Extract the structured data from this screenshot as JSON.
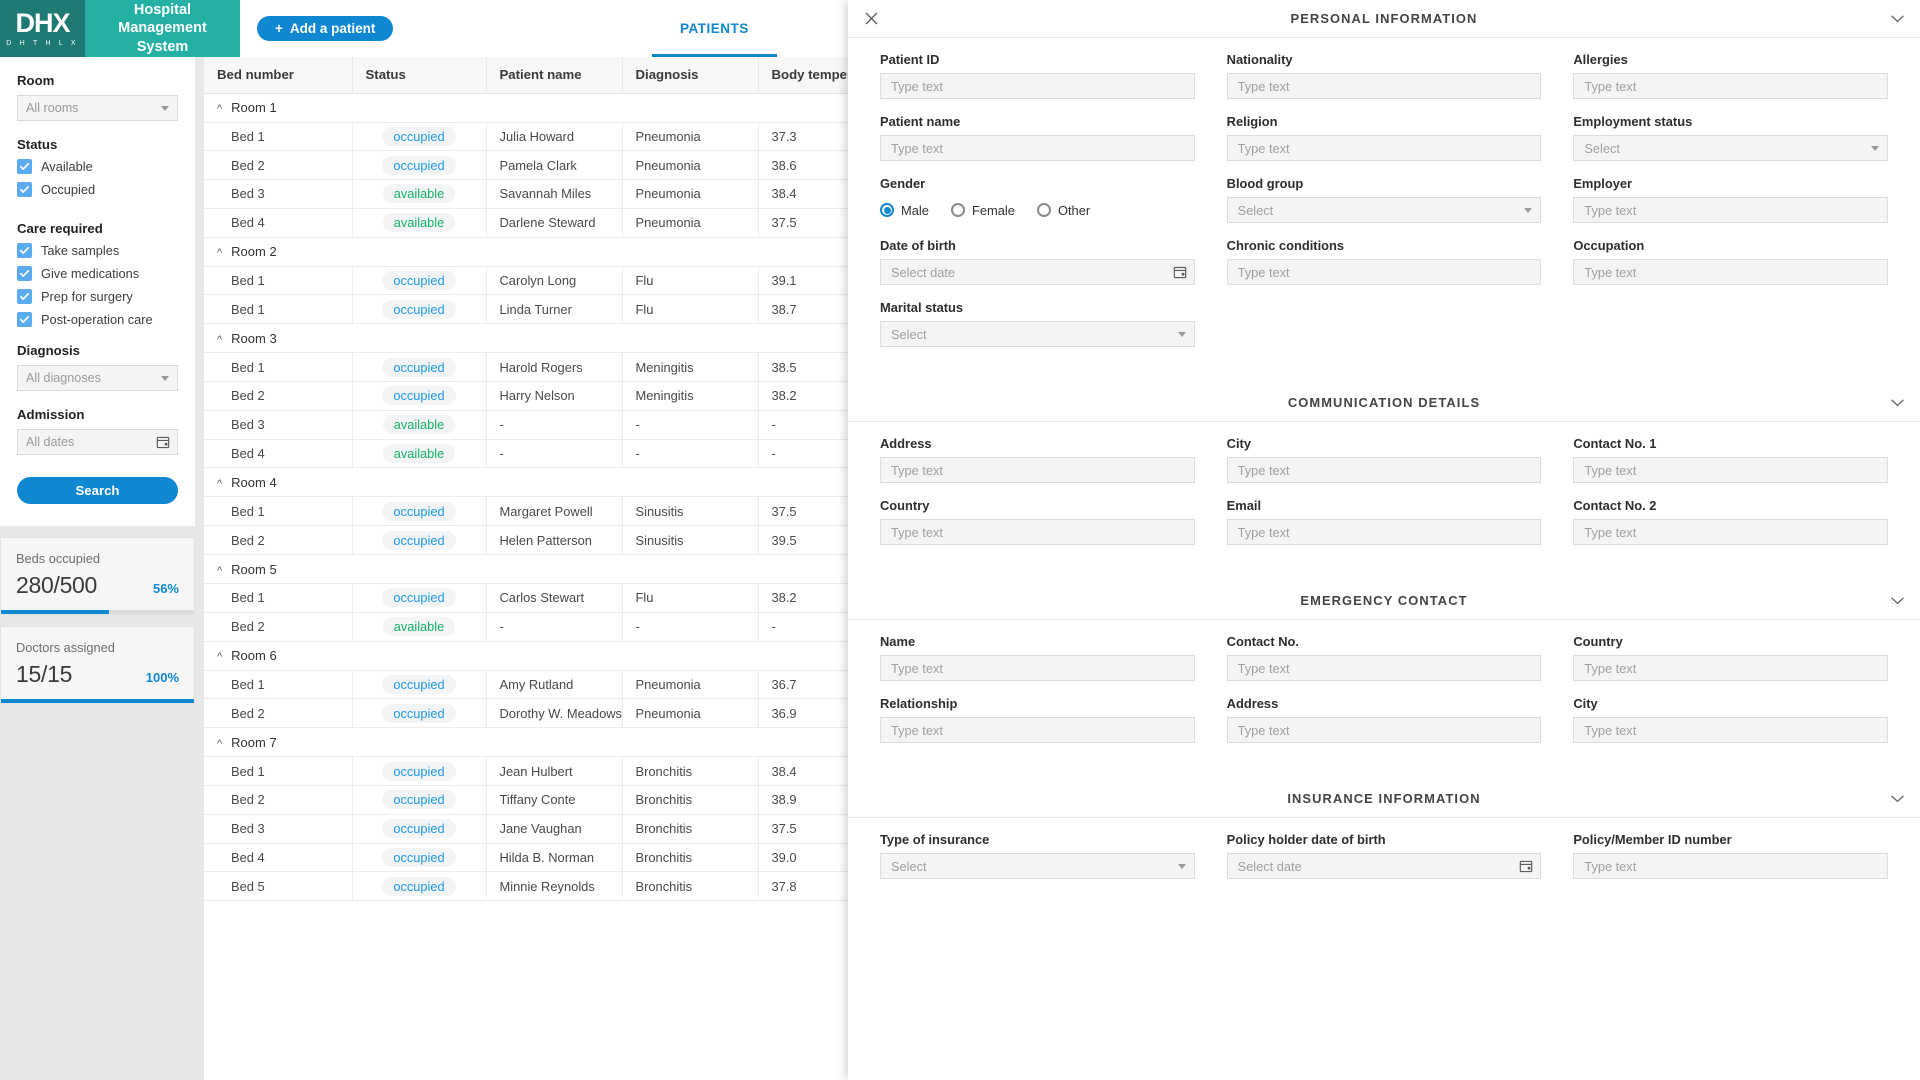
{
  "brand": {
    "logo_main": "DHX",
    "logo_sub": "D H T H L X",
    "title": "Hospital Management System",
    "teal_dark": "#1f7a74",
    "teal": "#25b0a5"
  },
  "toolbar": {
    "add_patient_label": "Add a patient",
    "plus_icon": "plus-icon",
    "accent": "#0f87d1"
  },
  "tabs": [
    {
      "label": "PATIENTS",
      "active": true
    }
  ],
  "sidebar": {
    "room": {
      "label": "Room",
      "value": "All rooms"
    },
    "status": {
      "label": "Status",
      "options": [
        {
          "label": "Available",
          "checked": true
        },
        {
          "label": "Occupied",
          "checked": true
        }
      ]
    },
    "care_required": {
      "label": "Care required",
      "options": [
        {
          "label": "Take samples",
          "checked": true
        },
        {
          "label": "Give medications",
          "checked": true
        },
        {
          "label": "Prep for surgery",
          "checked": true
        },
        {
          "label": "Post-operation care",
          "checked": true
        }
      ]
    },
    "diagnosis": {
      "label": "Diagnosis",
      "value": "All diagnoses"
    },
    "admission": {
      "label": "Admission",
      "value": "All dates"
    },
    "search_label": "Search",
    "stats": [
      {
        "title": "Beds occupied",
        "value": "280/500",
        "percent_label": "56%",
        "percent": 56
      },
      {
        "title": "Doctors assigned",
        "value": "15/15",
        "percent_label": "100%",
        "percent": 100
      }
    ]
  },
  "table": {
    "columns": [
      "Bed number",
      "Status",
      "Patient name",
      "Diagnosis",
      "Body temperature"
    ],
    "groups": [
      {
        "name": "Room 1",
        "rows": [
          {
            "bed": "Bed 1",
            "status": "occupied",
            "name": "Julia Howard",
            "diagnosis": "Pneumonia",
            "temp": "37.3"
          },
          {
            "bed": "Bed 2",
            "status": "occupied",
            "name": "Pamela Clark",
            "diagnosis": "Pneumonia",
            "temp": "38.6"
          },
          {
            "bed": "Bed 3",
            "status": "available",
            "name": "Savannah Miles",
            "diagnosis": "Pneumonia",
            "temp": "38.4"
          },
          {
            "bed": "Bed 4",
            "status": "available",
            "name": "Darlene Steward",
            "diagnosis": "Pneumonia",
            "temp": "37.5"
          }
        ]
      },
      {
        "name": "Room 2",
        "rows": [
          {
            "bed": "Bed 1",
            "status": "occupied",
            "name": "Carolyn Long",
            "diagnosis": "Flu",
            "temp": "39.1"
          },
          {
            "bed": "Bed 1",
            "status": "occupied",
            "name": "Linda Turner",
            "diagnosis": "Flu",
            "temp": "38.7"
          }
        ]
      },
      {
        "name": "Room 3",
        "rows": [
          {
            "bed": "Bed 1",
            "status": "occupied",
            "name": "Harold Rogers",
            "diagnosis": "Meningitis",
            "temp": "38.5"
          },
          {
            "bed": "Bed 2",
            "status": "occupied",
            "name": "Harry Nelson",
            "diagnosis": "Meningitis",
            "temp": "38.2"
          },
          {
            "bed": "Bed 3",
            "status": "available",
            "name": "-",
            "diagnosis": "-",
            "temp": "-"
          },
          {
            "bed": "Bed 4",
            "status": "available",
            "name": "-",
            "diagnosis": "-",
            "temp": "-"
          }
        ]
      },
      {
        "name": "Room 4",
        "rows": [
          {
            "bed": "Bed 1",
            "status": "occupied",
            "name": "Margaret Powell",
            "diagnosis": "Sinusitis",
            "temp": "37.5"
          },
          {
            "bed": "Bed 2",
            "status": "occupied",
            "name": "Helen Patterson",
            "diagnosis": "Sinusitis",
            "temp": "39.5"
          }
        ]
      },
      {
        "name": "Room 5",
        "rows": [
          {
            "bed": "Bed 1",
            "status": "occupied",
            "name": "Carlos Stewart",
            "diagnosis": "Flu",
            "temp": "38.2"
          },
          {
            "bed": "Bed 2",
            "status": "available",
            "name": "-",
            "diagnosis": "-",
            "temp": "-"
          }
        ]
      },
      {
        "name": "Room 6",
        "rows": [
          {
            "bed": "Bed 1",
            "status": "occupied",
            "name": "Amy Rutland",
            "diagnosis": "Pneumonia",
            "temp": "36.7"
          },
          {
            "bed": "Bed 2",
            "status": "occupied",
            "name": "Dorothy W. Meadows",
            "diagnosis": "Pneumonia",
            "temp": "36.9"
          }
        ]
      },
      {
        "name": "Room 7",
        "rows": [
          {
            "bed": "Bed 1",
            "status": "occupied",
            "name": "Jean Hulbert",
            "diagnosis": "Bronchitis",
            "temp": "38.4"
          },
          {
            "bed": "Bed 2",
            "status": "occupied",
            "name": "Tiffany Conte",
            "diagnosis": "Bronchitis",
            "temp": "38.9"
          },
          {
            "bed": "Bed 3",
            "status": "occupied",
            "name": "Jane Vaughan",
            "diagnosis": "Bronchitis",
            "temp": "37.5"
          },
          {
            "bed": "Bed 4",
            "status": "occupied",
            "name": "Hilda B. Norman",
            "diagnosis": "Bronchitis",
            "temp": "39.0"
          },
          {
            "bed": "Bed 5",
            "status": "occupied",
            "name": "Minnie Reynolds",
            "diagnosis": "Bronchitis",
            "temp": "37.8"
          }
        ]
      }
    ],
    "status_colors": {
      "occupied": "#1f9ae8",
      "available": "#17b169"
    }
  },
  "panel": {
    "close_icon": "close-icon",
    "chevron_icon": "chevron-down-icon",
    "placeholders": {
      "text": "Type text",
      "select": "Select",
      "date": "Select date"
    },
    "sections": [
      {
        "title": "PERSONAL INFORMATION",
        "columns": [
          [
            {
              "label": "Patient ID",
              "type": "text",
              "value": "Type text"
            },
            {
              "label": "Patient name",
              "type": "text",
              "value": "Type text"
            },
            {
              "label": "Gender",
              "type": "radio",
              "options": [
                "Male",
                "Female",
                "Other"
              ],
              "selected": "Male"
            },
            {
              "label": "Date of birth",
              "type": "date",
              "value": "Select date"
            },
            {
              "label": "Marital status",
              "type": "select",
              "value": "Select"
            }
          ],
          [
            {
              "label": "Nationality",
              "type": "text",
              "value": "Type text"
            },
            {
              "label": "Religion",
              "type": "text",
              "value": "Type text"
            },
            {
              "label": "Blood group",
              "type": "select",
              "value": "Select"
            },
            {
              "label": "Chronic conditions",
              "type": "text",
              "value": "Type text"
            }
          ],
          [
            {
              "label": "Allergies",
              "type": "text",
              "value": "Type text"
            },
            {
              "label": "Employment status",
              "type": "select",
              "value": "Select"
            },
            {
              "label": "Employer",
              "type": "text",
              "value": "Type text"
            },
            {
              "label": "Occupation",
              "type": "text",
              "value": "Type text"
            }
          ]
        ]
      },
      {
        "title": "COMMUNICATION DETAILS",
        "columns": [
          [
            {
              "label": "Address",
              "type": "text",
              "value": "Type text"
            },
            {
              "label": "Country",
              "type": "text",
              "value": "Type text"
            }
          ],
          [
            {
              "label": "City",
              "type": "text",
              "value": "Type text"
            },
            {
              "label": "Email",
              "type": "text",
              "value": "Type text"
            }
          ],
          [
            {
              "label": "Contact No. 1",
              "type": "text",
              "value": "Type text"
            },
            {
              "label": "Contact No. 2",
              "type": "text",
              "value": "Type text"
            }
          ]
        ]
      },
      {
        "title": "EMERGENCY CONTACT",
        "columns": [
          [
            {
              "label": "Name",
              "type": "text",
              "value": "Type text"
            },
            {
              "label": "Relationship",
              "type": "text",
              "value": "Type text"
            }
          ],
          [
            {
              "label": "Contact No.",
              "type": "text",
              "value": "Type text"
            },
            {
              "label": "Address",
              "type": "text",
              "value": "Type text"
            }
          ],
          [
            {
              "label": "Country",
              "type": "text",
              "value": "Type text"
            },
            {
              "label": "City",
              "type": "text",
              "value": "Type text"
            }
          ]
        ]
      },
      {
        "title": "INSURANCE INFORMATION",
        "columns": [
          [
            {
              "label": "Type of insurance",
              "type": "select",
              "value": "Select"
            }
          ],
          [
            {
              "label": "Policy holder date of birth",
              "type": "date",
              "value": "Select date"
            }
          ],
          [
            {
              "label": "Policy/Member ID number",
              "type": "text",
              "value": "Type text"
            }
          ]
        ]
      }
    ]
  }
}
